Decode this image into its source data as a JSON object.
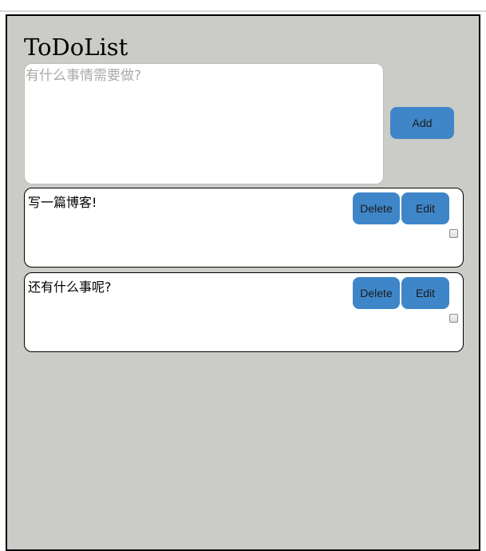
{
  "app": {
    "title": "ToDoList",
    "new_task_placeholder": "有什么事情需要做?",
    "add_label": "Add"
  },
  "todos": [
    {
      "text": "写一篇博客!",
      "delete_label": "Delete",
      "edit_label": "Edit",
      "done": false
    },
    {
      "text": "还有什么事呢?",
      "delete_label": "Delete",
      "edit_label": "Edit",
      "done": false
    }
  ],
  "colors": {
    "background": "#cbccc7",
    "button": "#3f86c8",
    "card": "#ffffff"
  }
}
